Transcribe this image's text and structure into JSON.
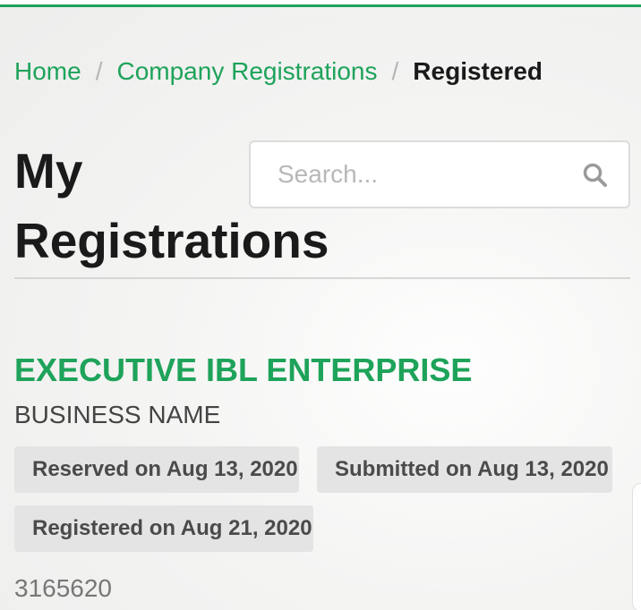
{
  "colors": {
    "accent": "#1ea35a",
    "text": "#1a1a1a",
    "badge_bg": "#e4e4e4"
  },
  "breadcrumb": {
    "items": [
      {
        "label": "Home"
      },
      {
        "label": "Company Registrations"
      },
      {
        "label": "Registered"
      }
    ],
    "separator": "/"
  },
  "page": {
    "title": "My Registrations"
  },
  "search": {
    "placeholder": "Search...",
    "value": "",
    "icon": "search-icon"
  },
  "registration": {
    "name": "EXECUTIVE IBL ENTERPRISE",
    "type": "BUSINESS NAME",
    "badges": {
      "reserved": "Reserved on Aug 13, 2020",
      "submitted": "Submitted on Aug 13, 2020",
      "registered": "Registered on Aug 21, 2020"
    },
    "number": "3165620"
  }
}
